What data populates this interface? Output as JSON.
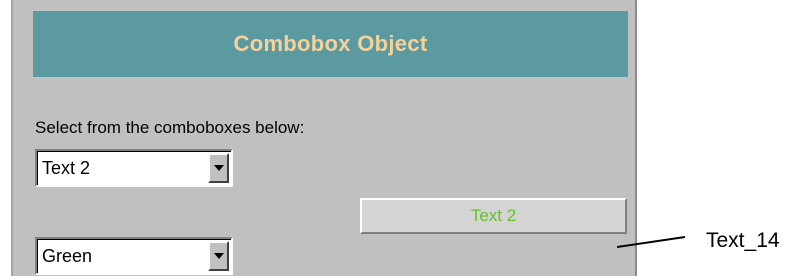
{
  "header": {
    "title": "Combobox Object"
  },
  "instruction": "Select from the comboboxes below:",
  "combobox1": {
    "value": "Text 2"
  },
  "combobox2": {
    "value": "Green"
  },
  "display_field": {
    "value": "Text 2",
    "text_color": "#66c02a"
  },
  "callout": {
    "label": "Text_14"
  },
  "colors": {
    "panel_bg": "#c0c0c0",
    "header_bg": "#5b9aa0",
    "header_text": "#f6d19a"
  }
}
